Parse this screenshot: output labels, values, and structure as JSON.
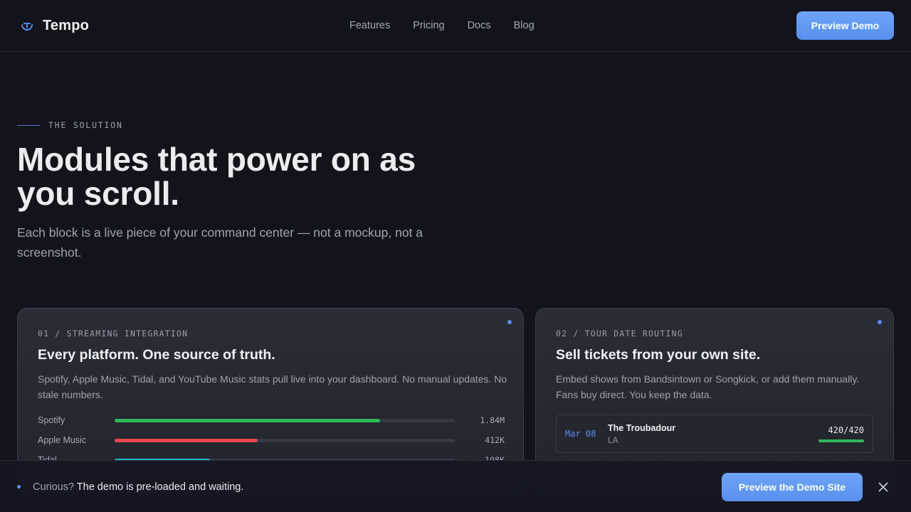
{
  "nav": {
    "brand": "Tempo",
    "logo_icon": "tempo-logo-icon",
    "links": [
      "Features",
      "Pricing",
      "Docs",
      "Blog"
    ],
    "cta": "Preview Demo"
  },
  "hero": {
    "eyebrow": "THE SOLUTION",
    "headline": "Modules that power on as you scroll.",
    "subtitle": "Each block is a live piece of your command center — not a mockup, not a screenshot."
  },
  "cards": [
    {
      "kicker": "01 / STREAMING INTEGRATION",
      "title": "Every platform. One source of truth.",
      "description": "Spotify, Apple Music, Tidal, and YouTube Music stats pull live into your dashboard. No manual updates. No stale numbers.",
      "stats": [
        {
          "label": "Spotify",
          "value": "1.84M",
          "fill_fraction": 0.78,
          "color": "#2fb75a"
        },
        {
          "label": "Apple Music",
          "value": "412K",
          "fill_fraction": 0.42,
          "color": "#e5484d"
        },
        {
          "label": "Tidal",
          "value": "198K",
          "fill_fraction": 0.28,
          "color": "#1fb6c9"
        }
      ]
    },
    {
      "kicker": "02 / TOUR DATE ROUTING",
      "title": "Sell tickets from your own site.",
      "description": "Embed shows from Bandsintown or Songkick, or add them manually. Fans buy direct. You keep the data.",
      "shows": [
        {
          "date": "Mar 08",
          "venue": "The Troubadour",
          "city": "LA",
          "capacity": "420/420",
          "sold_fraction": 1.0
        }
      ]
    }
  ],
  "banner": {
    "muted": "Curious?",
    "message": " The demo is pre-loaded and waiting.",
    "cta": "Preview the Demo Site",
    "close_icon": "close-icon"
  },
  "colors": {
    "accent": "#5b8def",
    "background": "#13131b",
    "success": "#2fb75a",
    "danger": "#e5484d",
    "teal": "#1fb6c9"
  }
}
